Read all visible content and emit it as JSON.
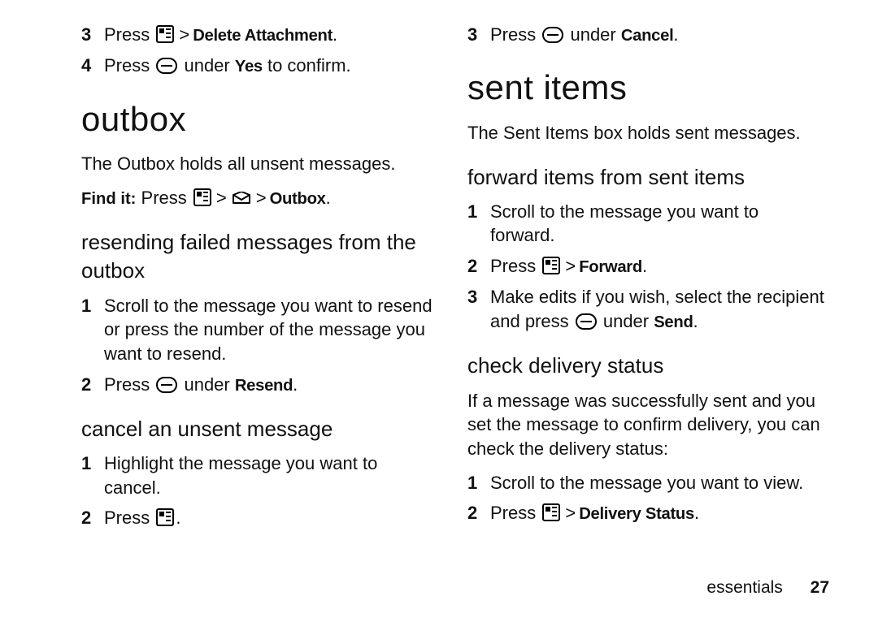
{
  "left": {
    "presteps": [
      {
        "num": "3",
        "pre": "Press ",
        "action": "Delete Attachment",
        "icon": "menu",
        "gtBefore": " > "
      },
      {
        "num": "4",
        "pre": "Press ",
        "mid": " under ",
        "action": "Yes",
        "post": " to confirm.",
        "icon": "soft"
      }
    ],
    "h1": "outbox",
    "intro": "The Outbox holds all unsent messages.",
    "findit_label": "Find it:",
    "findit_press": " Press ",
    "findit_dest": "Outbox",
    "h2a": "resending failed messages from the outbox",
    "resend_steps": [
      {
        "num": "1",
        "text": "Scroll to the message you want to resend or press the number of the message you want to resend."
      },
      {
        "num": "2",
        "pre": "Press ",
        "mid": " under ",
        "action": "Resend",
        "post": ".",
        "icon": "soft"
      }
    ],
    "h2b": "cancel an unsent message",
    "cancel_steps": [
      {
        "num": "1",
        "text": "Highlight the message you want to cancel."
      },
      {
        "num": "2",
        "pre": "Press ",
        "post": ".",
        "icon": "menu"
      }
    ]
  },
  "right": {
    "presteps": [
      {
        "num": "3",
        "pre": "Press ",
        "mid": " under ",
        "action": "Cancel",
        "post": ".",
        "icon": "soft"
      }
    ],
    "h1": "sent items",
    "intro": "The Sent Items box holds sent messages.",
    "h2a": "forward items from sent items",
    "fwd_steps": [
      {
        "num": "1",
        "text": "Scroll to the message you want to forward."
      },
      {
        "num": "2",
        "pre": "Press ",
        "gt": " > ",
        "action": "Forward",
        "post": ".",
        "icon": "menu"
      },
      {
        "num": "3",
        "text_a": "Make edits if you wish, select the recipient and press ",
        "mid": " under ",
        "action": "Send",
        "post": ".",
        "icon": "soft"
      }
    ],
    "h2b": "check delivery status",
    "check_intro": "If a message was successfully sent and you set the message to confirm delivery, you can check the delivery status:",
    "check_steps": [
      {
        "num": "1",
        "text": "Scroll to the message you want to view."
      },
      {
        "num": "2",
        "pre": "Press ",
        "gt": " > ",
        "action": "Delivery Status",
        "post": ".",
        "icon": "menu"
      }
    ]
  },
  "footer": {
    "section": "essentials",
    "page": "27"
  }
}
